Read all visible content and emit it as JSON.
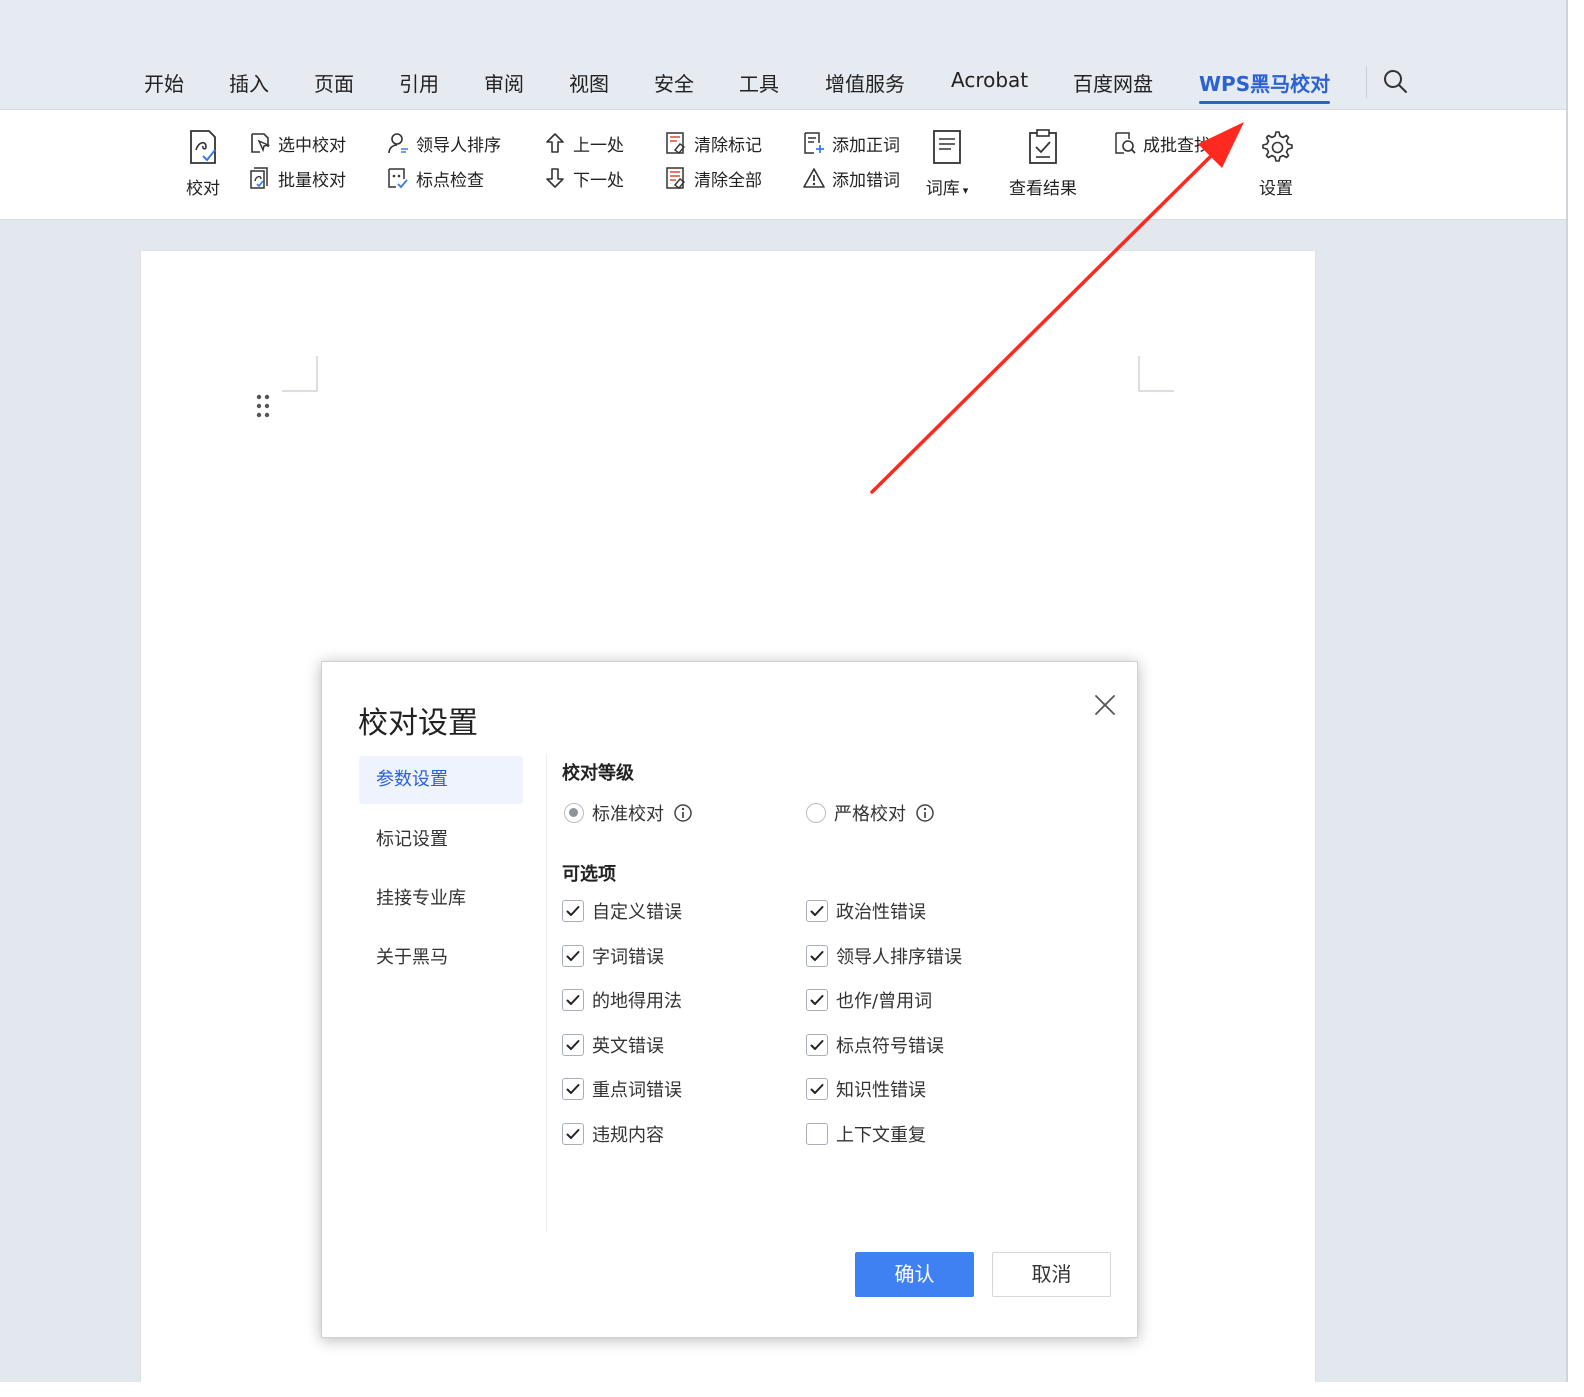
{
  "tabs": [
    {
      "label": "开始",
      "active": false
    },
    {
      "label": "插入",
      "active": false
    },
    {
      "label": "页面",
      "active": false
    },
    {
      "label": "引用",
      "active": false
    },
    {
      "label": "审阅",
      "active": false
    },
    {
      "label": "视图",
      "active": false
    },
    {
      "label": "安全",
      "active": false
    },
    {
      "label": "工具",
      "active": false
    },
    {
      "label": "增值服务",
      "active": false
    },
    {
      "label": "Acrobat",
      "active": false
    },
    {
      "label": "百度网盘",
      "active": false
    },
    {
      "label": "WPS黑马校对",
      "active": true
    }
  ],
  "ribbon": {
    "proofread": "校对",
    "select_proofread": "选中校对",
    "batch_proofread": "批量校对",
    "leader_sort": "领导人排序",
    "punct_check": "标点检查",
    "prev": "上一处",
    "next": "下一处",
    "clear_marks": "清除标记",
    "clear_all": "清除全部",
    "add_correct": "添加正词",
    "add_error": "添加错词",
    "lexicon": "词库",
    "view_results": "查看结果",
    "batch_find": "成批查找",
    "settings": "设置"
  },
  "dialog": {
    "title": "校对设置",
    "nav": [
      {
        "label": "参数设置",
        "active": true
      },
      {
        "label": "标记设置",
        "active": false
      },
      {
        "label": "挂接专业库",
        "active": false
      },
      {
        "label": "关于黑马",
        "active": false
      }
    ],
    "level_title": "校对等级",
    "levels": [
      {
        "label": "标准校对",
        "selected": true
      },
      {
        "label": "严格校对",
        "selected": false
      }
    ],
    "options_title": "可选项",
    "options": [
      {
        "label": "自定义错误",
        "checked": true
      },
      {
        "label": "政治性错误",
        "checked": true
      },
      {
        "label": "字词错误",
        "checked": true
      },
      {
        "label": "领导人排序错误",
        "checked": true
      },
      {
        "label": "的地得用法",
        "checked": true
      },
      {
        "label": "也作/曾用词",
        "checked": true
      },
      {
        "label": "英文错误",
        "checked": true
      },
      {
        "label": "标点符号错误",
        "checked": true
      },
      {
        "label": "重点词错误",
        "checked": true
      },
      {
        "label": "知识性错误",
        "checked": true
      },
      {
        "label": "违规内容",
        "checked": true
      },
      {
        "label": "上下文重复",
        "checked": false
      }
    ],
    "confirm": "确认",
    "cancel": "取消"
  },
  "colors": {
    "accent": "#2a62d6",
    "primary_button": "#3f80f3",
    "annotation_arrow": "#ff2a1f"
  }
}
